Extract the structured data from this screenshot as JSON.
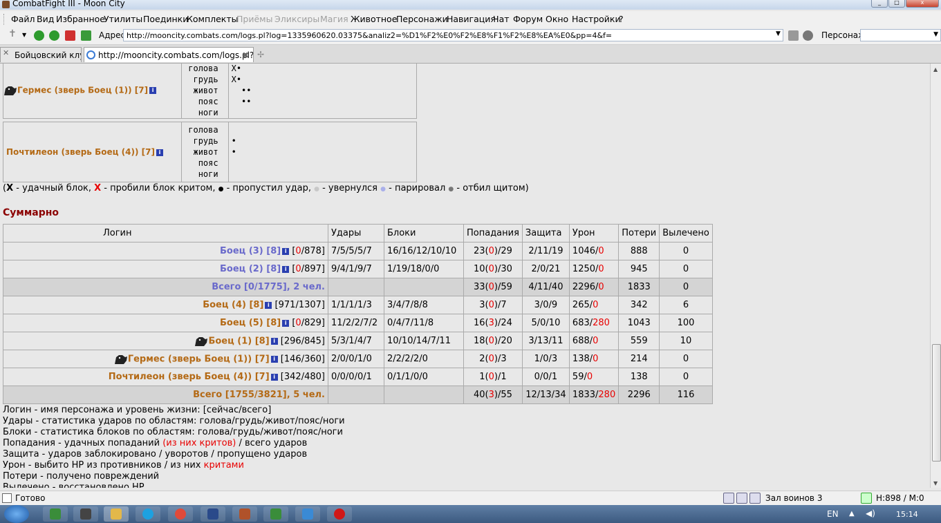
{
  "window": {
    "title": "CombatFight III - Moon City"
  },
  "menu": {
    "items": [
      {
        "label": "Файл",
        "enabled": true
      },
      {
        "label": "Вид",
        "enabled": true
      },
      {
        "label": "Избранное",
        "enabled": true
      },
      {
        "label": "Утилиты",
        "enabled": true
      },
      {
        "label": "Поединки",
        "enabled": true
      },
      {
        "label": "Комплекты",
        "enabled": true
      },
      {
        "label": "Приёмы",
        "enabled": false
      },
      {
        "label": "Эликсиры",
        "enabled": false
      },
      {
        "label": "Магия",
        "enabled": false
      },
      {
        "label": "Животное",
        "enabled": true
      },
      {
        "label": "Персонажи",
        "enabled": true
      },
      {
        "label": "Навигация",
        "enabled": true
      },
      {
        "label": "Чат",
        "enabled": true
      },
      {
        "label": "Форум",
        "enabled": true
      },
      {
        "label": "Окно",
        "enabled": true
      },
      {
        "label": "Настройки",
        "enabled": true
      },
      {
        "label": "?",
        "enabled": true
      }
    ]
  },
  "toolbar": {
    "address_label": "Адрес:",
    "address_value": "http://mooncity.combats.com/logs.pl?log=1335960620.03375&analiz2=%D1%F2%E0%F2%E8%F1%F2%E8%EA%E0&pp=4&f=",
    "character_label": "Персонаж:",
    "character_value": ""
  },
  "tabs": [
    {
      "label": "Бойцовский клуб",
      "active": false
    },
    {
      "label": "http://mooncity.combats.com/logs.pl?l...",
      "active": true
    }
  ],
  "zones": [
    "голова",
    "грудь",
    "живот",
    "пояс",
    "ноги"
  ],
  "zone_rows": [
    {
      "name": "Гермес (зверь Боец (1)) [7]",
      "has_icon": true,
      "marks": [
        "X•",
        "X•",
        "  ••",
        "  ••",
        ""
      ]
    },
    {
      "name": "Почтилеон (зверь Боец (4)) [7]",
      "has_icon": false,
      "marks": [
        "",
        "•",
        "•",
        "",
        ""
      ]
    }
  ],
  "legend": {
    "open": "(",
    "x_black": "X",
    "t1": " - удачный блок, ",
    "x_red": "X",
    "t2": " - пробили блок критом, ",
    "dot_black": "●",
    "t3": " - пропустил удар, ",
    "dot_gray": "●",
    "t4": " - увернулся ",
    "dot_blue": "●",
    "t5": " - парировал ",
    "dot_dark": "●",
    "t6": " - отбил щитом)"
  },
  "summary": {
    "title": "Суммарно",
    "headers": [
      "Логин",
      "Удары",
      "Блоки",
      "Попадания",
      "Защита",
      "Урон",
      "Потери",
      "Вылечено"
    ],
    "rows": [
      {
        "name": "Боец (3) [8]",
        "team": "blue",
        "icon": false,
        "hp_now": "0",
        "hp_total": "878",
        "hits": "7/5/5/5/7",
        "blocks": "16/16/12/10/10",
        "hit_n": "23",
        "hit_crit": "0",
        "hit_total": "29",
        "defense": "2/11/19",
        "dmg": "1046",
        "dmg_crit": "0",
        "losses": "888",
        "healed": "0",
        "total": false
      },
      {
        "name": "Боец (2) [8]",
        "team": "blue",
        "icon": false,
        "hp_now": "0",
        "hp_total": "897",
        "hits": "9/4/1/9/7",
        "blocks": "1/19/18/0/0",
        "hit_n": "10",
        "hit_crit": "0",
        "hit_total": "30",
        "defense": "2/0/21",
        "dmg": "1250",
        "dmg_crit": "0",
        "losses": "945",
        "healed": "0",
        "total": false
      },
      {
        "name": "Всего [0/1775], 2 чел.",
        "team": "blue",
        "icon": false,
        "hits": "",
        "blocks": "",
        "hit_n": "33",
        "hit_crit": "0",
        "hit_total": "59",
        "defense": "4/11/40",
        "dmg": "2296",
        "dmg_crit": "0",
        "losses": "1833",
        "healed": "0",
        "total": true
      },
      {
        "name": "Боец (4) [8]",
        "team": "gold",
        "icon": false,
        "hp_now": "971",
        "hp_total": "1307",
        "hits": "1/1/1/1/3",
        "blocks": "3/4/7/8/8",
        "hit_n": "3",
        "hit_crit": "0",
        "hit_total": "7",
        "defense": "3/0/9",
        "dmg": "265",
        "dmg_crit": "0",
        "losses": "342",
        "healed": "6",
        "total": false
      },
      {
        "name": "Боец (5) [8]",
        "team": "gold",
        "icon": false,
        "hp_now": "0",
        "hp_total": "829",
        "hits": "11/2/2/7/2",
        "blocks": "0/4/7/11/8",
        "hit_n": "16",
        "hit_crit": "3",
        "hit_total": "24",
        "defense": "5/0/10",
        "dmg": "683",
        "dmg_crit": "280",
        "losses": "1043",
        "healed": "100",
        "total": false
      },
      {
        "name": "Боец (1) [8]",
        "team": "gold",
        "icon": true,
        "hp_now": "296",
        "hp_total": "845",
        "hits": "5/3/1/4/7",
        "blocks": "10/10/14/7/11",
        "hit_n": "18",
        "hit_crit": "0",
        "hit_total": "20",
        "defense": "3/13/11",
        "dmg": "688",
        "dmg_crit": "0",
        "losses": "559",
        "healed": "10",
        "total": false
      },
      {
        "name": "Гермес (зверь Боец (1)) [7]",
        "team": "gold",
        "icon": true,
        "hp_now": "146",
        "hp_total": "360",
        "hits": "2/0/0/1/0",
        "blocks": "2/2/2/2/0",
        "hit_n": "2",
        "hit_crit": "0",
        "hit_total": "3",
        "defense": "1/0/3",
        "dmg": "138",
        "dmg_crit": "0",
        "losses": "214",
        "healed": "0",
        "total": false
      },
      {
        "name": "Почтилеон (зверь Боец (4)) [7]",
        "team": "gold",
        "icon": false,
        "hp_now": "342",
        "hp_total": "480",
        "hits": "0/0/0/0/1",
        "blocks": "0/1/1/0/0",
        "hit_n": "1",
        "hit_crit": "0",
        "hit_total": "1",
        "defense": "0/0/1",
        "dmg": "59",
        "dmg_crit": "0",
        "losses": "138",
        "healed": "0",
        "total": false
      },
      {
        "name": "Всего [1755/3821], 5 чел.",
        "team": "gold",
        "icon": false,
        "hits": "",
        "blocks": "",
        "hit_n": "40",
        "hit_crit": "3",
        "hit_total": "55",
        "defense": "12/13/34",
        "dmg": "1833",
        "dmg_crit": "280",
        "losses": "2296",
        "healed": "116",
        "total": true
      }
    ]
  },
  "notes": [
    {
      "text": "Логин - имя персонажа и уровень жизни: [сейчас/всего]",
      "red": "",
      "after": ""
    },
    {
      "text": "Удары - статистика ударов по областям: голова/грудь/живот/пояс/ноги",
      "red": "",
      "after": ""
    },
    {
      "text": "Блоки - статистика блоков по областям: голова/грудь/живот/пояс/ноги",
      "red": "",
      "after": ""
    },
    {
      "text": "Попадания - удачных попаданий ",
      "red": "(из них критов)",
      "after": " / всего ударов"
    },
    {
      "text": "Защита - ударов заблокировано / уворотов / пропущено ударов",
      "red": "",
      "after": ""
    },
    {
      "text": "Урон - выбито HP из противников / из них ",
      "red": "критами",
      "after": ""
    },
    {
      "text": "Потери - получено повреждений",
      "red": "",
      "after": ""
    },
    {
      "text": "Вылечено - восстановлено HP",
      "red": "",
      "after": ""
    }
  ],
  "status": {
    "text": "Готово",
    "room": "Зал воинов 3",
    "hp": "H:898 / M:0"
  },
  "taskbar": {
    "lang": "EN",
    "time": "15:14"
  },
  "colors": {
    "blue_team": "#6a6acb",
    "gold_team": "#b46a16",
    "crit": "#e80000",
    "summary_title": "#8b0000"
  }
}
